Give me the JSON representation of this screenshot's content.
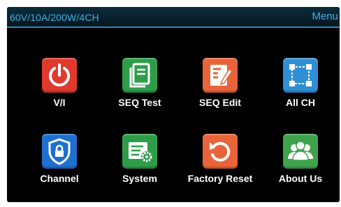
{
  "header": {
    "model": "60V/10A/200W/4CH",
    "menu_label": "Menu"
  },
  "tiles": [
    {
      "label": "V/I",
      "icon": "power-icon",
      "color": "#e03a2e"
    },
    {
      "label": "SEQ Test",
      "icon": "notebook-icon",
      "color": "#2e9d4a"
    },
    {
      "label": "SEQ Edit",
      "icon": "edit-document-icon",
      "color": "#e9643a"
    },
    {
      "label": "All CH",
      "icon": "all-channels-icon",
      "color": "#2f8fd6"
    },
    {
      "label": "Channel",
      "icon": "shield-lock-icon",
      "color": "#1f6fcf"
    },
    {
      "label": "System",
      "icon": "settings-card-icon",
      "color": "#2e9d4a"
    },
    {
      "label": "Factory Reset",
      "icon": "reset-icon",
      "color": "#e9643a"
    },
    {
      "label": "About Us",
      "icon": "users-icon",
      "color": "#3fa34d"
    }
  ]
}
